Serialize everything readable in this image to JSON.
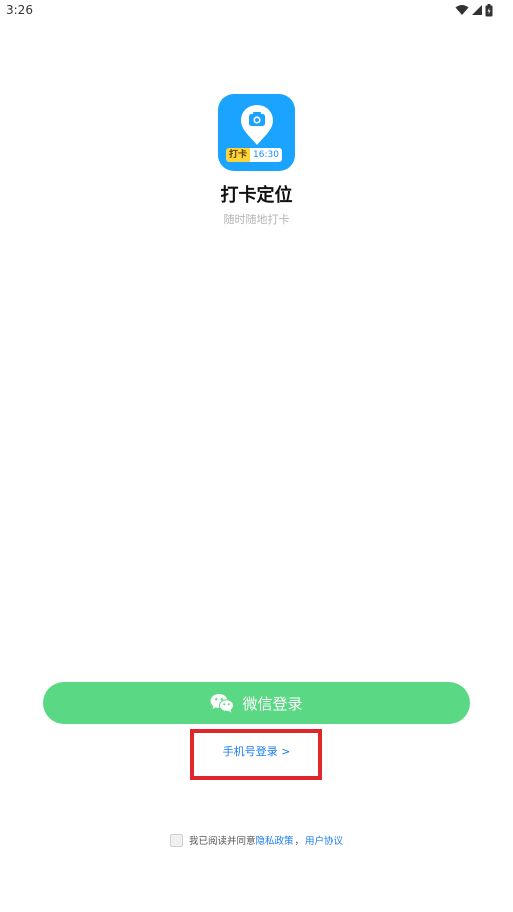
{
  "status_bar": {
    "time": "3:26"
  },
  "app": {
    "name": "打卡定位",
    "slogan": "随时随地打卡",
    "icon_tag_left": "打卡",
    "icon_tag_right": "16:30"
  },
  "login": {
    "wechat_label": "微信登录",
    "phone_label": "手机号登录 >"
  },
  "agreement": {
    "prefix": "我已阅读并同意",
    "privacy_link": "隐私政策",
    "separator": "，",
    "user_link": "用户协议",
    "checked": false
  },
  "colors": {
    "brand_blue": "#1aa3ff",
    "wechat_green": "#5ad884",
    "link_blue": "#1a7cf0",
    "highlight_red": "#e0252b"
  },
  "icons": [
    "wifi-icon",
    "cellular-signal-icon",
    "battery-icon",
    "location-camera-icon",
    "wechat-icon"
  ]
}
